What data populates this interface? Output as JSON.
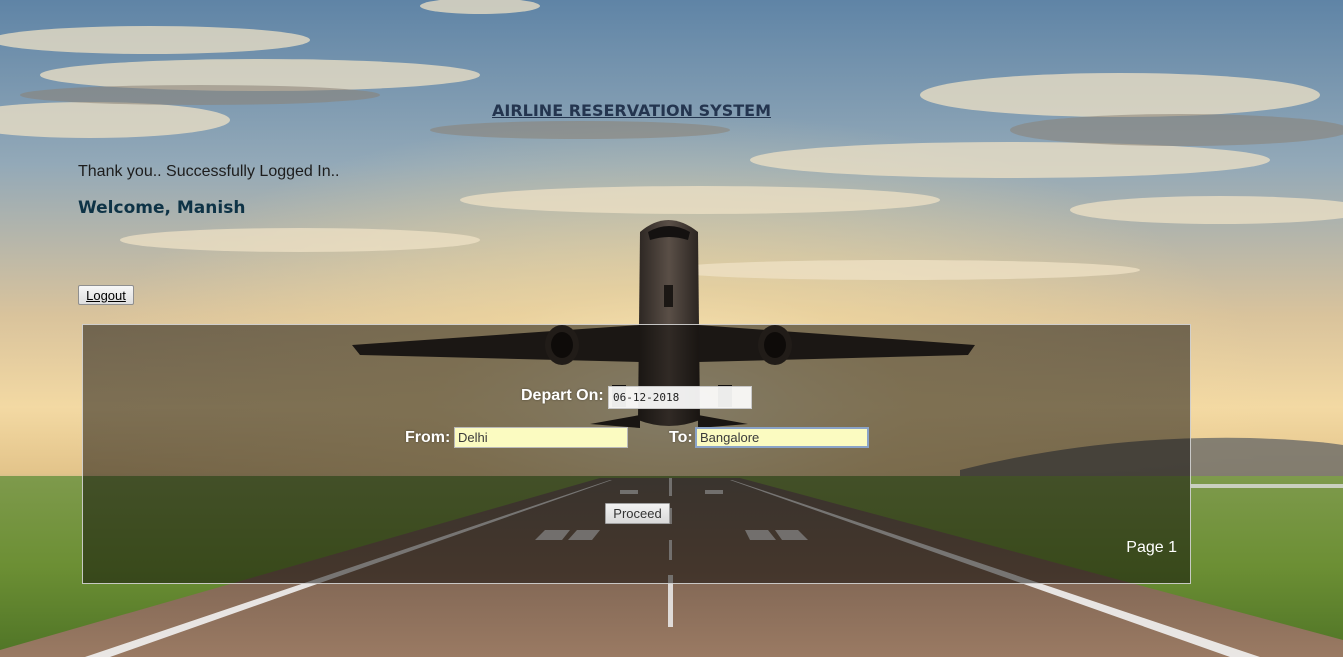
{
  "header": {
    "title": "AIRLINE RESERVATION SYSTEM",
    "login_message": "Thank you.. Successfully Logged In..",
    "welcome": "Welcome, Manish",
    "logout_label": "Logout"
  },
  "booking": {
    "depart_label": "Depart On:",
    "depart_value": "06-12-2018",
    "from_label": "From:",
    "from_value": "Delhi",
    "to_label": "To:",
    "to_value": "Bangalore",
    "proceed_label": "Proceed",
    "page_label": "Page 1"
  },
  "colors": {
    "title": "#24354f",
    "welcome": "#0e3346",
    "input_bg": "#fbfbc1",
    "panel_overlay": "rgba(8,6,4,0.5)"
  }
}
